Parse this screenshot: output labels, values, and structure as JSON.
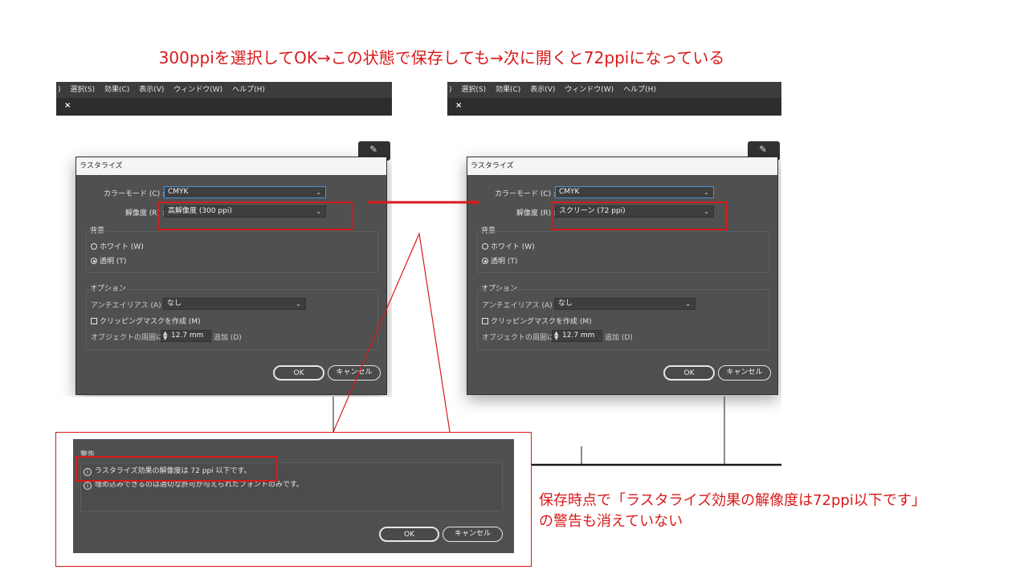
{
  "headline": "300ppiを選択してOK→この状態で保存しても→次に開くと72ppiになっている",
  "menu": {
    "partial": ")",
    "items": [
      "選択(S)",
      "効果(C)",
      "表示(V)",
      "ウィンドウ(W)",
      "ヘルプ(H)"
    ]
  },
  "tab_close": "×",
  "dialog_before": {
    "title": "ラスタライズ",
    "color_mode_label": "カラーモード (C) :",
    "color_mode_value": "CMYK",
    "resolution_label": "解像度 (R) :",
    "resolution_value": "高解像度 (300 ppi)",
    "background_label": "背景",
    "white_option": "ホワイト (W)",
    "transparent_option": "透明 (T)",
    "options_label": "オプション",
    "antialias_label": "アンチエイリアス (A) :",
    "antialias_value": "なし",
    "clip_mask_label": "クリッピングマスクを作成 (M)",
    "around_label": "オブジェクトの周囲に :",
    "around_value": "12.7 mm",
    "add_label": "追加 (D)",
    "ok_label": "OK",
    "cancel_label": "キャンセル"
  },
  "dialog_after": {
    "title": "ラスタライズ",
    "color_mode_label": "カラーモード (C) :",
    "color_mode_value": "CMYK",
    "resolution_label": "解像度 (R) :",
    "resolution_value": "スクリーン (72 ppi)",
    "background_label": "背景",
    "white_option": "ホワイト (W)",
    "transparent_option": "透明 (T)",
    "options_label": "オプション",
    "antialias_label": "アンチエイリアス (A) :",
    "antialias_value": "なし",
    "clip_mask_label": "クリッピングマスクを作成 (M)",
    "around_label": "オブジェクトの周囲に :",
    "around_value": "12.7 mm",
    "add_label": "追加 (D)",
    "ok_label": "OK",
    "cancel_label": "キャンセル"
  },
  "warning_dialog": {
    "title": "警告",
    "line1": "ラスタライズ効果の解像度は 72 ppi 以下です。",
    "line2": "埋め込みできるのは適切な許可が与えられたフォントのみです。",
    "ok_label": "OK",
    "cancel_label": "キャンセル"
  },
  "note": {
    "line1": "保存時点で「ラスタライズ効果の解像度は72ppi以下です」",
    "line2": "の警告も消えていない"
  },
  "colors": {
    "annotation_red": "#d91a1a",
    "dialog_bg": "#505050",
    "menubar_bg": "#3c3c3c"
  }
}
